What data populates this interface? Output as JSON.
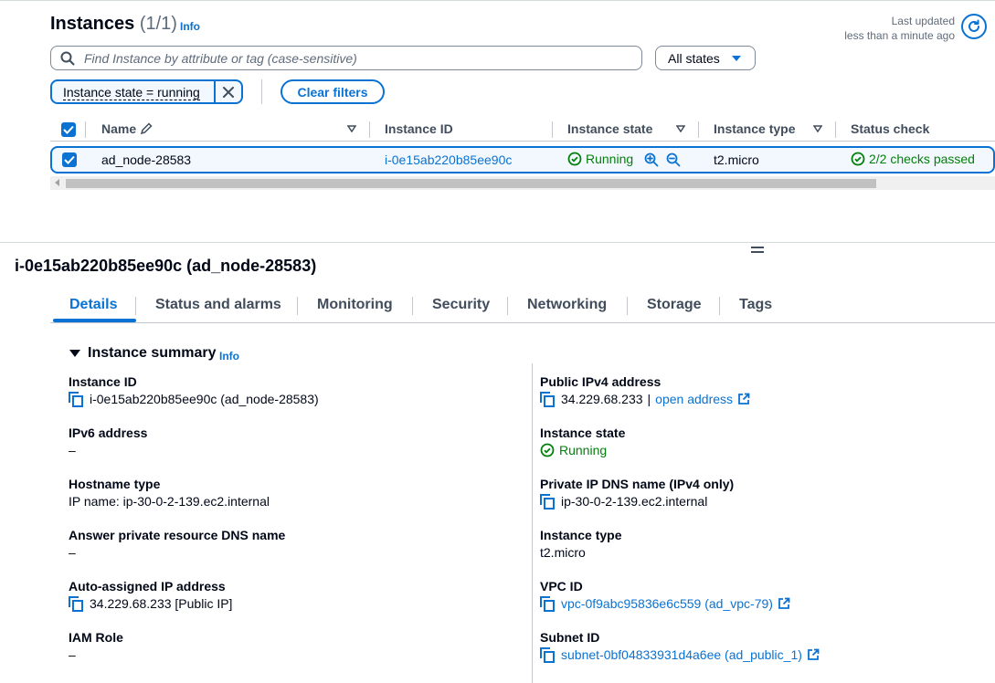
{
  "header": {
    "title": "Instances",
    "count": "(1/1)",
    "info": "Info",
    "last_updated_label": "Last updated",
    "last_updated_value": "less than a minute ago"
  },
  "search": {
    "placeholder": "Find Instance by attribute or tag (case-sensitive)",
    "value": ""
  },
  "states_filter": {
    "selected": "All states"
  },
  "filter_tokens": [
    {
      "label": "Instance state = running"
    }
  ],
  "clear_filters_label": "Clear filters",
  "table": {
    "columns": [
      "Name",
      "Instance ID",
      "Instance state",
      "Instance type",
      "Status check"
    ],
    "rows": [
      {
        "name": "ad_node-28583",
        "instance_id": "i-0e15ab220b85ee90c",
        "instance_state": "Running",
        "instance_type": "t2.micro",
        "status_check": "2/2 checks passed"
      }
    ]
  },
  "details": {
    "title": "i-0e15ab220b85ee90c (ad_node-28583)",
    "tabs": [
      "Details",
      "Status and alarms",
      "Monitoring",
      "Security",
      "Networking",
      "Storage",
      "Tags"
    ],
    "active_tab": "Details",
    "summary_title": "Instance summary",
    "summary_info": "Info",
    "left": [
      {
        "label": "Instance ID",
        "value": "i-0e15ab220b85ee90c (ad_node-28583)"
      },
      {
        "label": "IPv6 address",
        "value": "–"
      },
      {
        "label": "Hostname type",
        "value": "IP name: ip-30-0-2-139.ec2.internal"
      },
      {
        "label": "Answer private resource DNS name",
        "value": "–"
      },
      {
        "label": "Auto-assigned IP address",
        "value": "34.229.68.233 [Public IP]"
      },
      {
        "label": "IAM Role",
        "value": "–"
      }
    ],
    "right": {
      "public_ipv4_label": "Public IPv4 address",
      "public_ipv4_value": "34.229.68.233",
      "public_ipv4_sep": "|",
      "open_address": "open address",
      "instance_state_label": "Instance state",
      "instance_state_value": "Running",
      "private_dns_label": "Private IP DNS name (IPv4 only)",
      "private_dns_value": "ip-30-0-2-139.ec2.internal",
      "instance_type_label": "Instance type",
      "instance_type_value": "t2.micro",
      "vpc_label": "VPC ID",
      "vpc_value": "vpc-0f9abc95836e6c559 (ad_vpc-79)",
      "subnet_label": "Subnet ID",
      "subnet_value": "subnet-0bf04833931d4a6ee (ad_public_1)"
    }
  },
  "colors": {
    "accent": "#0972d3",
    "success": "#037f0c",
    "text": "#000716",
    "muted": "#5f6b7a",
    "selected_row_bg": "#f2f8fd"
  },
  "icons": {
    "refresh": "refresh-icon",
    "search": "search-icon",
    "dropdown": "caret-down-icon",
    "close": "close-icon",
    "edit": "pencil-icon",
    "sort": "sort-caret-icon",
    "status_ok": "check-circle-icon",
    "zoom_in": "zoom-in-icon",
    "zoom_out": "zoom-out-icon",
    "copy": "copy-icon",
    "external": "external-link-icon",
    "expand": "triangle-down-icon"
  }
}
